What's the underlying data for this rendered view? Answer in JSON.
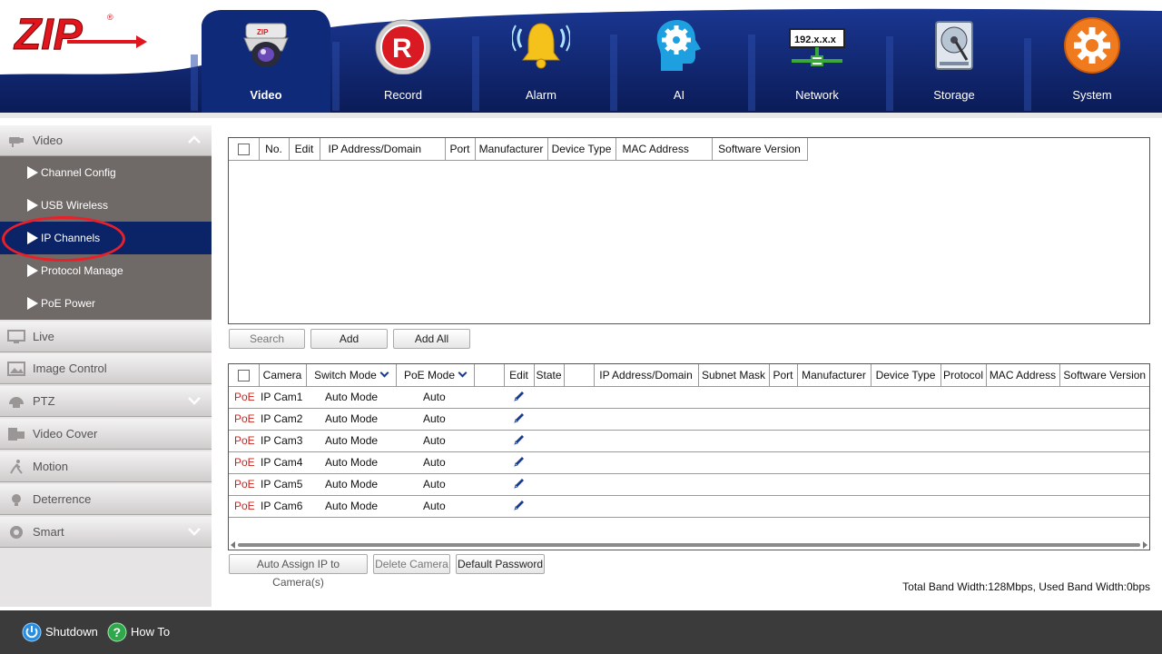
{
  "nav": {
    "items": [
      {
        "label": "Video",
        "icon": "dome-camera-icon",
        "active": true
      },
      {
        "label": "Record",
        "icon": "record-icon"
      },
      {
        "label": "Alarm",
        "icon": "alarm-bell-icon"
      },
      {
        "label": "AI",
        "icon": "ai-head-gear-icon"
      },
      {
        "label": "Network",
        "icon": "network-icon",
        "badge": "192.x.x.x"
      },
      {
        "label": "Storage",
        "icon": "hard-disk-icon"
      },
      {
        "label": "System",
        "icon": "system-gear-icon"
      }
    ]
  },
  "sidebar": {
    "video": {
      "label": "Video",
      "icon": "video-camera-icon"
    },
    "video_items": [
      {
        "label": "Channel Config"
      },
      {
        "label": "USB Wireless"
      },
      {
        "label": "IP Channels",
        "active": true
      },
      {
        "label": "Protocol Manage"
      },
      {
        "label": "PoE Power"
      }
    ],
    "sections": [
      {
        "label": "Live",
        "icon": "monitor-icon"
      },
      {
        "label": "Image Control",
        "icon": "image-icon"
      },
      {
        "label": "PTZ",
        "icon": "ptz-camera-icon"
      },
      {
        "label": "Video Cover",
        "icon": "video-cover-icon"
      },
      {
        "label": "Motion",
        "icon": "motion-person-icon"
      },
      {
        "label": "Deterrence",
        "icon": "lightbulb-icon"
      },
      {
        "label": "Smart",
        "icon": "smart-head-icon"
      }
    ]
  },
  "search_table": {
    "headers": [
      "No.",
      "Edit",
      "IP Address/Domain",
      "Port",
      "Manufacturer",
      "Device Type",
      "MAC Address",
      "Software Version"
    ]
  },
  "buttons": {
    "search": "Search",
    "add": "Add",
    "add_all": "Add All",
    "auto_assign": "Auto Assign IP to Camera(s)",
    "delete_camera": "Delete Camera",
    "default_password": "Default Password"
  },
  "camera_table": {
    "headers": [
      "Camera",
      "Switch Mode",
      "PoE Mode",
      "",
      "Edit",
      "State",
      "",
      "IP Address/Domain",
      "Subnet Mask",
      "Port",
      "Manufacturer",
      "Device Type",
      "Protocol",
      "MAC Address",
      "Software Version"
    ],
    "rows": [
      {
        "type": "PoE",
        "camera": "IP Cam1",
        "switch_mode": "Auto Mode",
        "poe_mode": "Auto"
      },
      {
        "type": "PoE",
        "camera": "IP Cam2",
        "switch_mode": "Auto Mode",
        "poe_mode": "Auto"
      },
      {
        "type": "PoE",
        "camera": "IP Cam3",
        "switch_mode": "Auto Mode",
        "poe_mode": "Auto"
      },
      {
        "type": "PoE",
        "camera": "IP Cam4",
        "switch_mode": "Auto Mode",
        "poe_mode": "Auto"
      },
      {
        "type": "PoE",
        "camera": "IP Cam5",
        "switch_mode": "Auto Mode",
        "poe_mode": "Auto"
      },
      {
        "type": "PoE",
        "camera": "IP Cam6",
        "switch_mode": "Auto Mode",
        "poe_mode": "Auto"
      }
    ]
  },
  "status": {
    "bandwidth": "Total Band Width:128Mbps, Used Band Width:0bps"
  },
  "footer": {
    "shutdown": "Shutdown",
    "how_to": "How To"
  },
  "colors": {
    "nav_band": "#0d2266",
    "sidebar_active": "#0b2468",
    "sidebar_sub": "#6f6968",
    "poe_text": "#c8241c",
    "footer": "#3b3b3b"
  }
}
